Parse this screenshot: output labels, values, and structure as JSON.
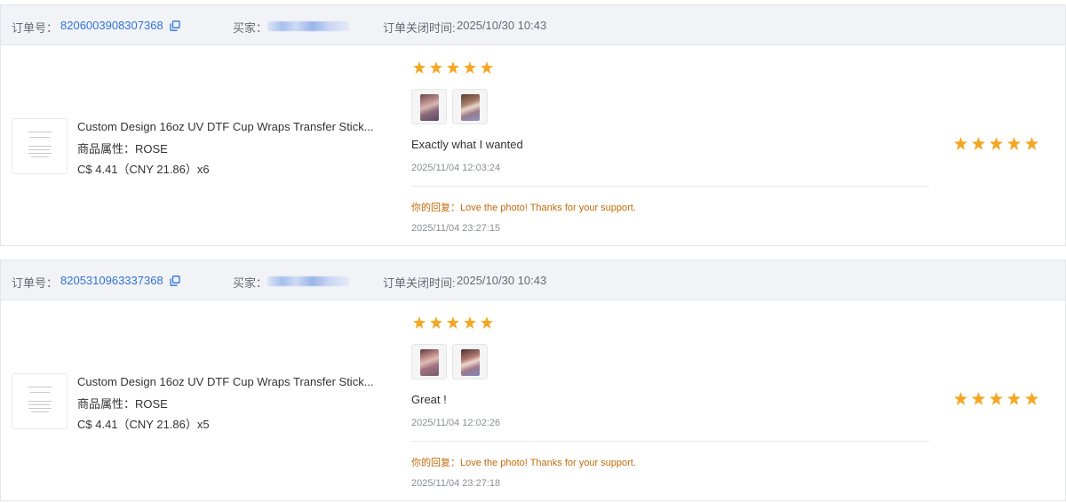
{
  "orders": [
    {
      "order_label": "订单号：",
      "order_no": "8206003908307368",
      "buyer_label": "买家：",
      "close_label": "订单关闭时间:",
      "close_time": "2025/10/30 10:43",
      "product": {
        "title": "Custom Design 16oz UV DTF Cup Wraps Transfer Stick...",
        "attr": "商品属性：ROSE",
        "price": "C$ 4.41（CNY  21.86）x6"
      },
      "review": {
        "rating": 5,
        "text": "Exactly what I wanted",
        "time": "2025/11/04 12:03:24",
        "reply": "你的回复：Love the photo! Thanks for your support.",
        "reply_time": "2025/11/04 23:27:15"
      },
      "store_rating": 5
    },
    {
      "order_label": "订单号：",
      "order_no": "8205310963337368",
      "buyer_label": "买家：",
      "close_label": "订单关闭时间:",
      "close_time": "2025/10/30 10:43",
      "product": {
        "title": "Custom Design 16oz UV DTF Cup Wraps Transfer Stick...",
        "attr": "商品属性：ROSE",
        "price": "C$ 4.41（CNY  21.86）x5"
      },
      "review": {
        "rating": 5,
        "text": "Great !",
        "time": "2025/11/04 12:02:26",
        "reply": "你的回复：Love the photo! Thanks for your support.",
        "reply_time": "2025/11/04 23:27:18"
      },
      "store_rating": 5
    }
  ],
  "colors": {
    "link": "#2f73d6",
    "star": "#f5a623",
    "reply": "#c26a0a",
    "header_bg": "#f2f3f6"
  },
  "icons": {
    "copy": "copy-icon",
    "star": "star-icon"
  }
}
